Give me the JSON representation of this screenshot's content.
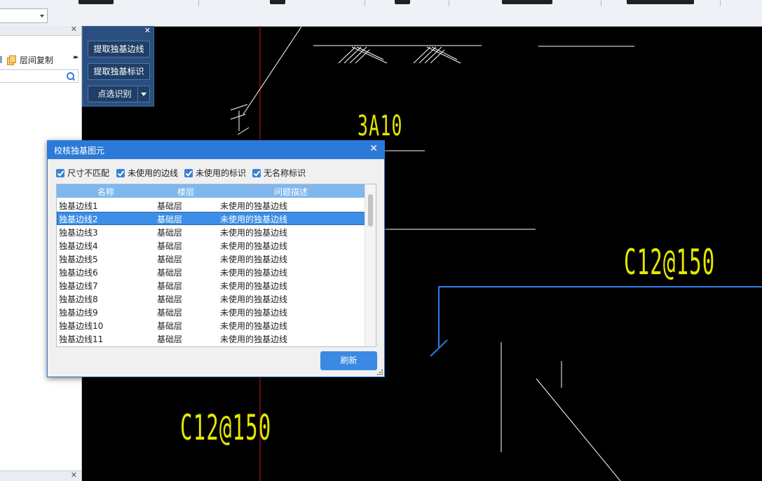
{
  "rec_panel": {
    "buttons": [
      "提取独基边线",
      "提取独基标识",
      "点选识别"
    ]
  },
  "left_panel": {
    "toolbar_label": "层间复制"
  },
  "cad_texts": [
    "3A10",
    "C12@150",
    "C12@150"
  ],
  "dialog": {
    "title": "校核独基图元",
    "filters": [
      "尺寸不匹配",
      "未使用的边线",
      "未使用的标识",
      "无名称标识"
    ],
    "columns": [
      "名称",
      "楼层",
      "问题描述"
    ],
    "rows": [
      [
        "独基边线1",
        "基础层",
        "未使用的独基边线"
      ],
      [
        "独基边线2",
        "基础层",
        "未使用的独基边线"
      ],
      [
        "独基边线3",
        "基础层",
        "未使用的独基边线"
      ],
      [
        "独基边线4",
        "基础层",
        "未使用的独基边线"
      ],
      [
        "独基边线5",
        "基础层",
        "未使用的独基边线"
      ],
      [
        "独基边线6",
        "基础层",
        "未使用的独基边线"
      ],
      [
        "独基边线7",
        "基础层",
        "未使用的独基边线"
      ],
      [
        "独基边线8",
        "基础层",
        "未使用的独基边线"
      ],
      [
        "独基边线9",
        "基础层",
        "未使用的独基边线"
      ],
      [
        "独基边线10",
        "基础层",
        "未使用的独基边线"
      ],
      [
        "独基边线11",
        "基础层",
        "未使用的独基边线"
      ]
    ],
    "selected_row": 1,
    "refresh_label": "刷新"
  },
  "colors": {
    "accent": "#2b7ad8",
    "cad_background": "#000000",
    "cad_text": "#e6e600"
  }
}
